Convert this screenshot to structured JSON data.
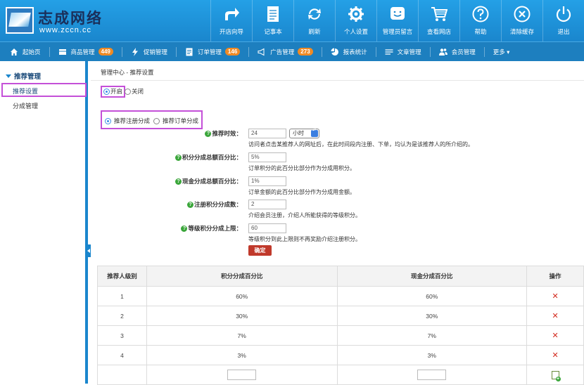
{
  "logo": {
    "cn": "志成网络",
    "en": "www.zccn.cc"
  },
  "top_nav": [
    {
      "label": "开店向导",
      "icon": "share-arrow-icon"
    },
    {
      "label": "记事本",
      "icon": "notepad-icon"
    },
    {
      "label": "刷新",
      "icon": "refresh-icon"
    },
    {
      "label": "个人设置",
      "icon": "gear-icon"
    },
    {
      "label": "管理员留言",
      "icon": "chat-face-icon"
    },
    {
      "label": "查看网店",
      "icon": "cart-icon"
    },
    {
      "label": "帮助",
      "icon": "help-icon"
    },
    {
      "label": "清除缓存",
      "icon": "close-circle-icon"
    },
    {
      "label": "退出",
      "icon": "power-icon"
    }
  ],
  "menu": {
    "home": "起始页",
    "goods": "商品管理",
    "goods_badge": "449",
    "promo": "促销管理",
    "orders": "订单管理",
    "orders_badge": "146",
    "ads": "广告管理",
    "ads_badge": "273",
    "stats": "报表统计",
    "articles": "文章管理",
    "members": "会员管理",
    "more": "更多 ▾"
  },
  "sidebar": {
    "heading": "推荐管理",
    "items": [
      "推荐设置",
      "分成管理"
    ]
  },
  "breadcrumb": "管理中心 - 推荐设置",
  "toggle": {
    "on": "开启",
    "off": "关闭",
    "selected": "on"
  },
  "split_type": {
    "register": "推荐注册分成",
    "order": "推荐订单分成",
    "selected": "register"
  },
  "form": {
    "valid_time": {
      "label": "推荐时效：",
      "value": "24",
      "unit": "小时",
      "note": "访问者点击某推荐人的网址后，在此时间段内注册、下单，均认为是该推荐人的所介绍的。"
    },
    "points_pct": {
      "label": "积分分成总额百分比：",
      "value": "5%",
      "note": "订单积分的此百分比部分作为分成用积分。"
    },
    "cash_pct": {
      "label": "现金分成总额百分比：",
      "value": "1%",
      "note": "订单金额的此百分比部分作为分成用金额。"
    },
    "register_points": {
      "label": "注册积分分成数：",
      "value": "2",
      "note": "介绍会员注册，介绍人所能获得的等级积分。"
    },
    "level_limit": {
      "label": "等级积分分成上限：",
      "value": "60",
      "note": "等级积分到此上限则不再奖励介绍注册积分。"
    },
    "submit": "确定"
  },
  "table": {
    "headers": [
      "推荐人级别",
      "积分分成百分比",
      "现金分成百分比",
      "操作"
    ],
    "rows": [
      [
        "1",
        "60%",
        "60%"
      ],
      [
        "2",
        "30%",
        "30%"
      ],
      [
        "3",
        "7%",
        "7%"
      ],
      [
        "4",
        "3%",
        "3%"
      ]
    ],
    "delete_icon": "✕"
  },
  "colors": {
    "topbar": "#1b8fd6",
    "menubar": "#1d7fbf",
    "badge": "#f08a24",
    "highlight": "#c450d8",
    "submit": "#c0392b"
  }
}
